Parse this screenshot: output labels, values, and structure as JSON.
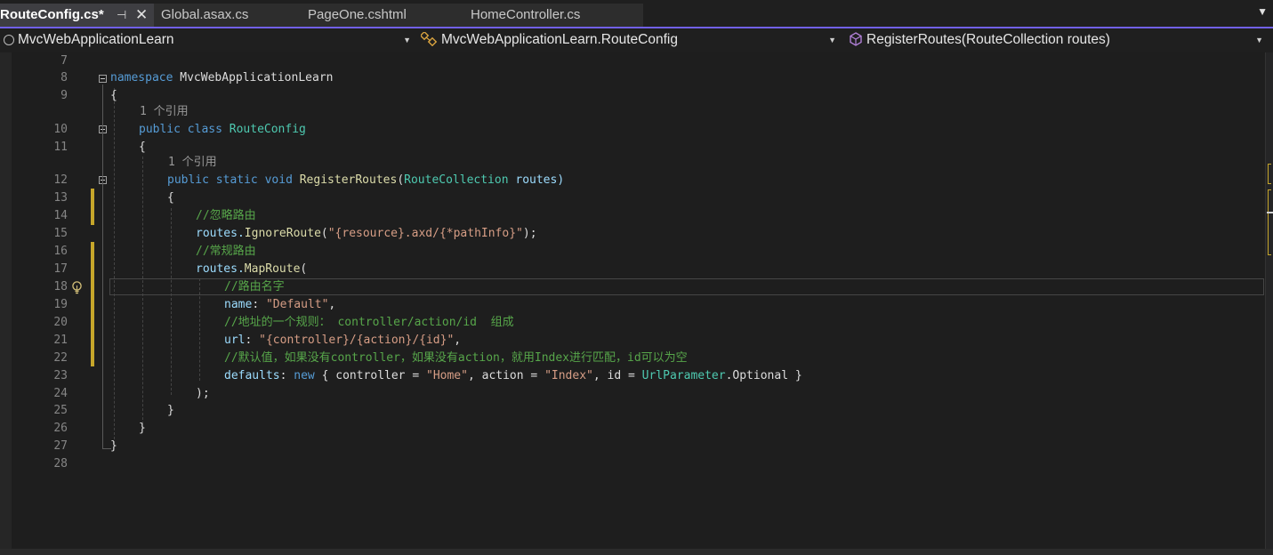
{
  "tabs": [
    {
      "label": "RouteConfig.cs*",
      "active": true,
      "pin_glyph": "⊣",
      "close_glyph": "✕"
    },
    {
      "label": "Global.asax.cs",
      "active": false
    },
    {
      "label": "PageOne.cshtml",
      "active": false
    },
    {
      "label": "HomeController.cs",
      "active": false
    }
  ],
  "tab_overflow_glyph": "▼",
  "navigation": {
    "project": "MvcWebApplicationLearn",
    "type": "MvcWebApplicationLearn.RouteConfig",
    "member": "RegisterRoutes(RouteCollection routes)",
    "dropdown_glyph": "▼"
  },
  "accent_color": "#7160e8",
  "line_numbers": [
    "7",
    "8",
    "9",
    "10",
    "11",
    "12",
    "13",
    "14",
    "15",
    "16",
    "17",
    "18",
    "19",
    "20",
    "21",
    "22",
    "23",
    "24",
    "25",
    "26",
    "27",
    "28"
  ],
  "code_lens": [
    "1 个引用",
    "1 个引用"
  ],
  "code": {
    "l8": [
      "namespace",
      " MvcWebApplicationLearn"
    ],
    "l9": "{",
    "l10": [
      "public",
      " ",
      "class",
      " ",
      "RouteConfig"
    ],
    "l11": "{",
    "l12": [
      "public",
      " ",
      "static",
      " ",
      "void",
      " ",
      "RegisterRoutes",
      "(",
      "RouteCollection",
      " routes)"
    ],
    "l13": "{",
    "l14": "//忽略路由",
    "l15": [
      "routes.",
      "IgnoreRoute",
      "(",
      "\"{resource}.axd/{*pathInfo}\"",
      ");"
    ],
    "l16": "//常规路由",
    "l17": [
      "routes.",
      "MapRoute",
      "("
    ],
    "l18": "//路由名字",
    "l19": [
      "name",
      ": ",
      "\"Default\"",
      ","
    ],
    "l20": "//地址的一个规则： controller/action/id  组成",
    "l21": [
      "url",
      ": ",
      "\"{controller}/{action}/{id}\"",
      ","
    ],
    "l22": "//默认值，如果没有controller，如果没有action，就用Index进行匹配，id可以为空",
    "l23": [
      "defaults",
      ": ",
      "new",
      " { controller = ",
      "\"Home\"",
      ", action = ",
      "\"Index\"",
      ", id = ",
      "UrlParameter",
      ".Optional }"
    ],
    "l24": ");",
    "l25": "}",
    "l26": "}",
    "l27": "}"
  }
}
